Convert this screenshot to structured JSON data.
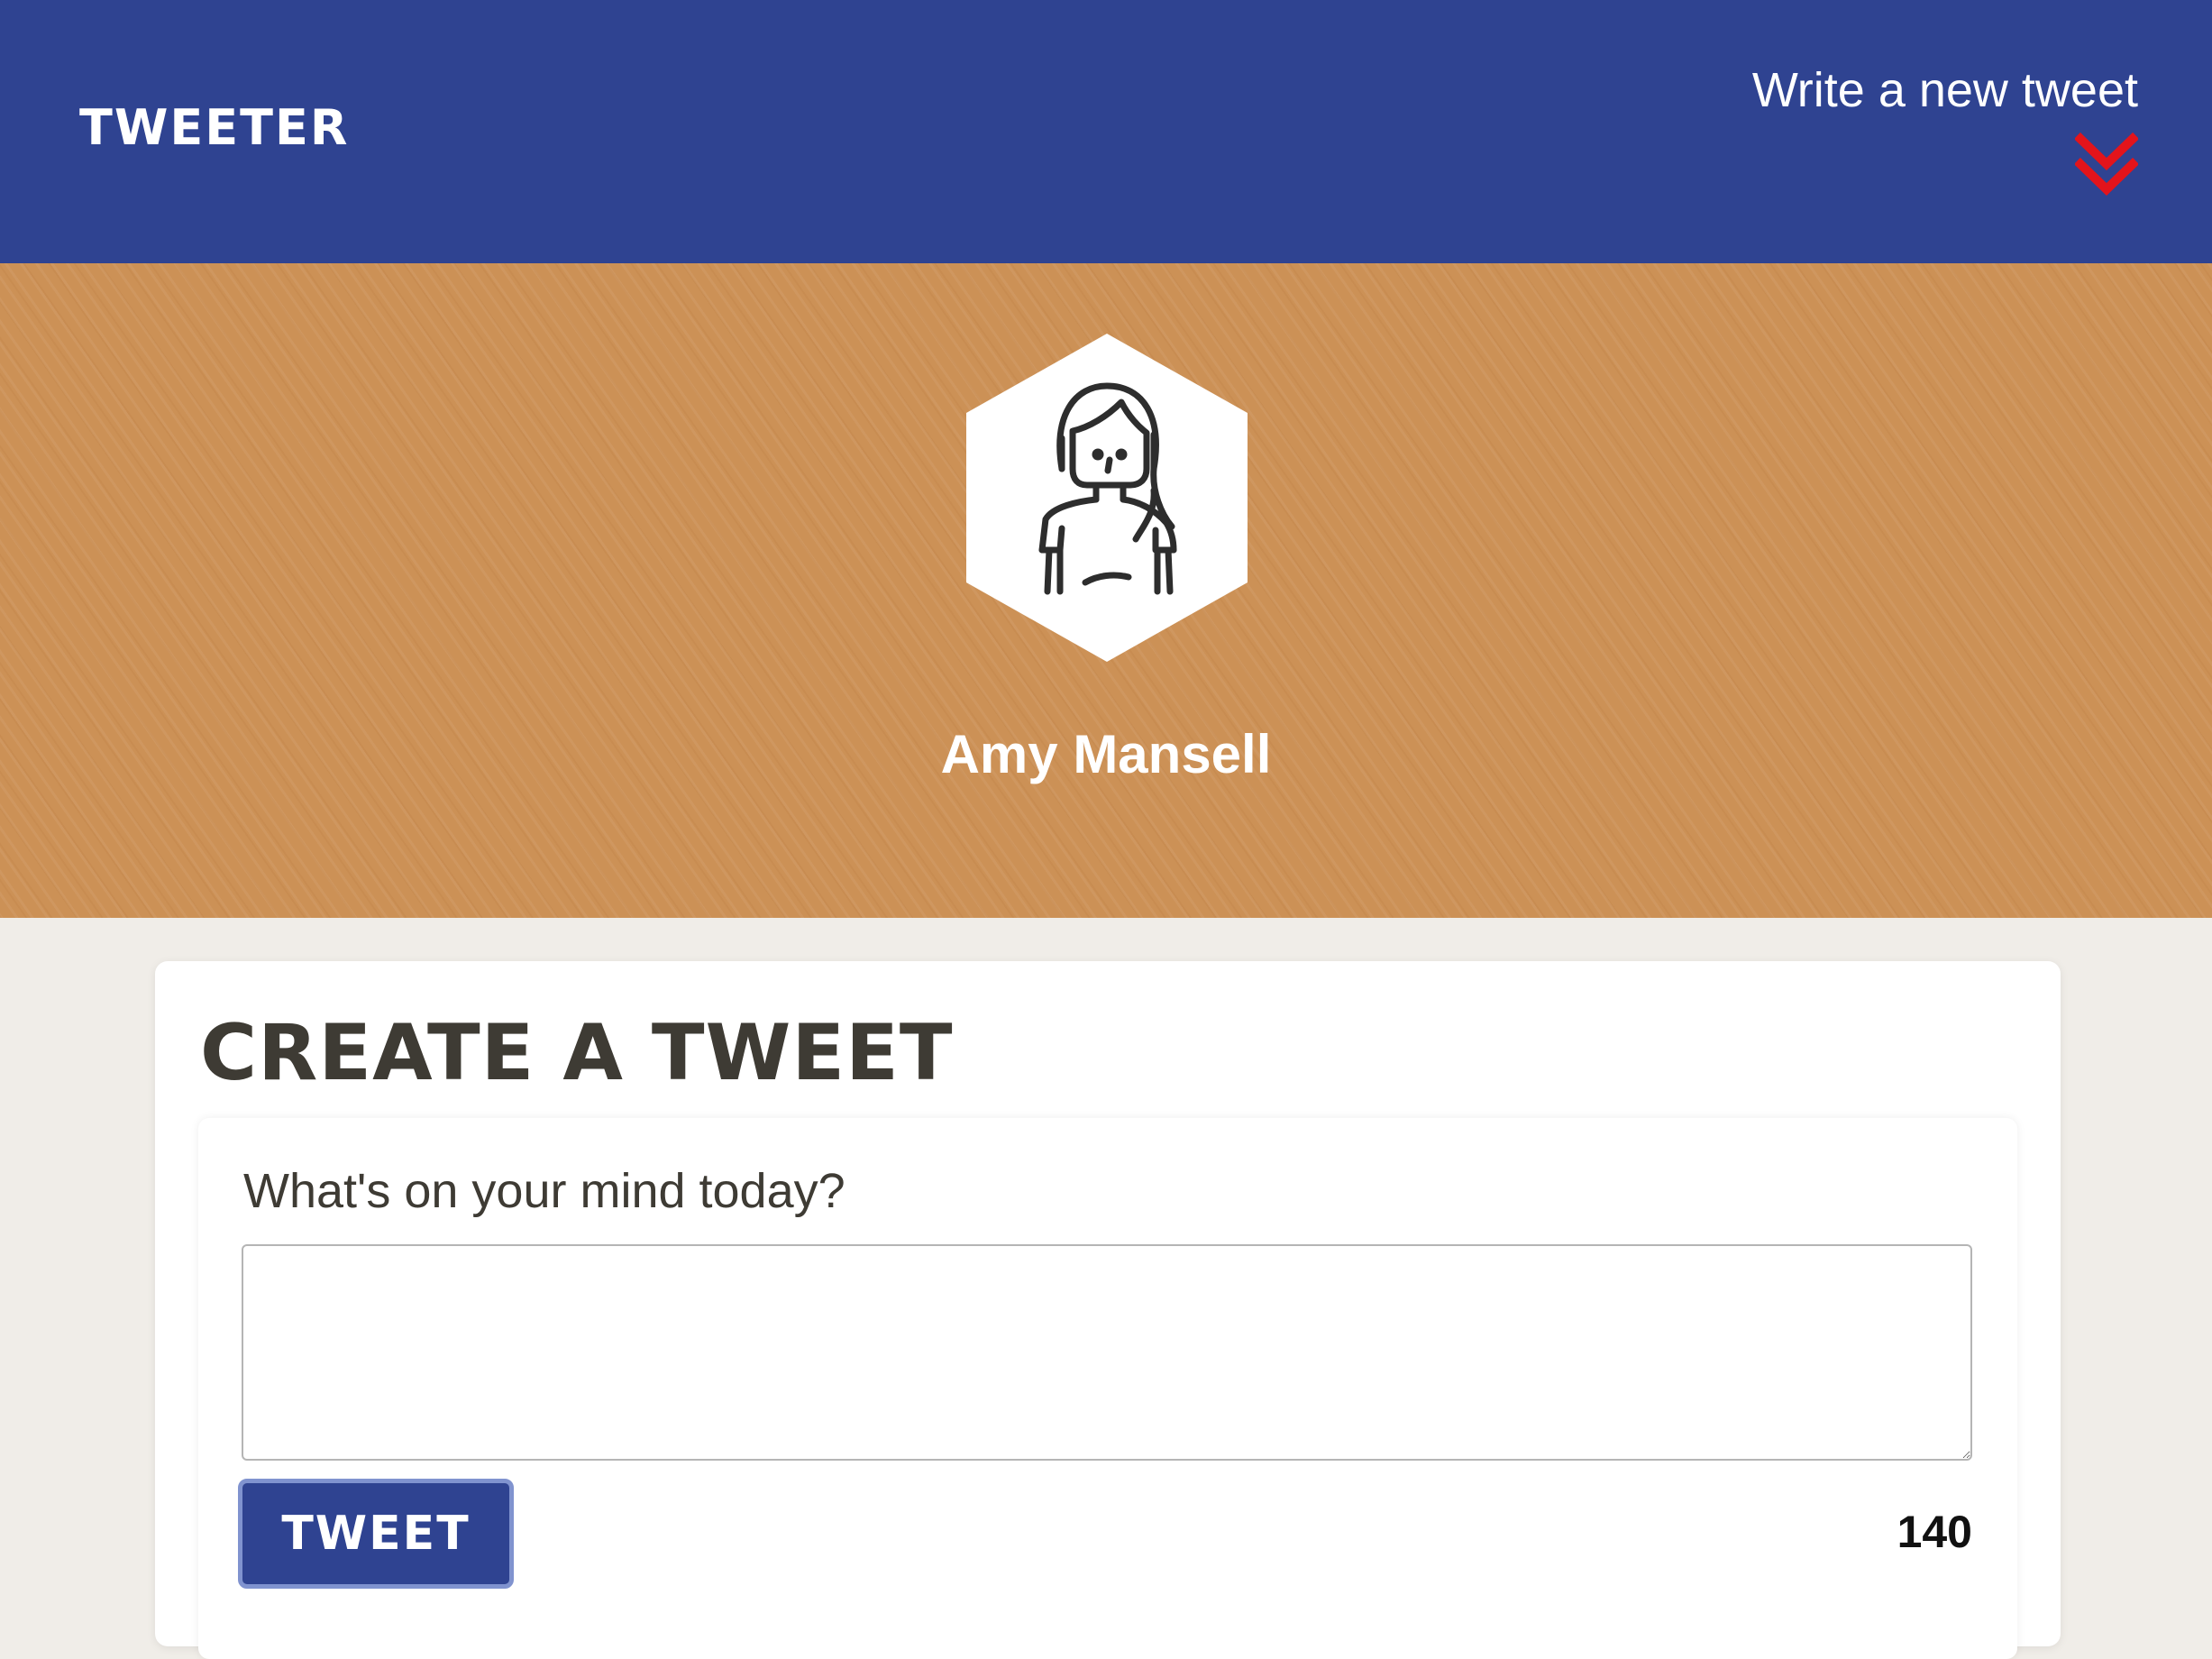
{
  "nav": {
    "brand": "TWEETER",
    "new_tweet_label": "Write a new tweet",
    "new_tweet_icon": "double-chevron-down-icon",
    "colors": {
      "background": "#2f4391",
      "chevron": "#e3141b"
    }
  },
  "profile": {
    "avatar_icon": "woman-avatar-icon",
    "name": "Amy Mansell",
    "colors": {
      "banner": "#cc9156"
    }
  },
  "compose": {
    "title": "Create a Tweet",
    "prompt": "What's on your mind today?",
    "textarea_value": "",
    "tweet_button_label": "Tweet",
    "char_counter": "140",
    "colors": {
      "button": "#2f4391",
      "title": "#3e3b34"
    }
  }
}
